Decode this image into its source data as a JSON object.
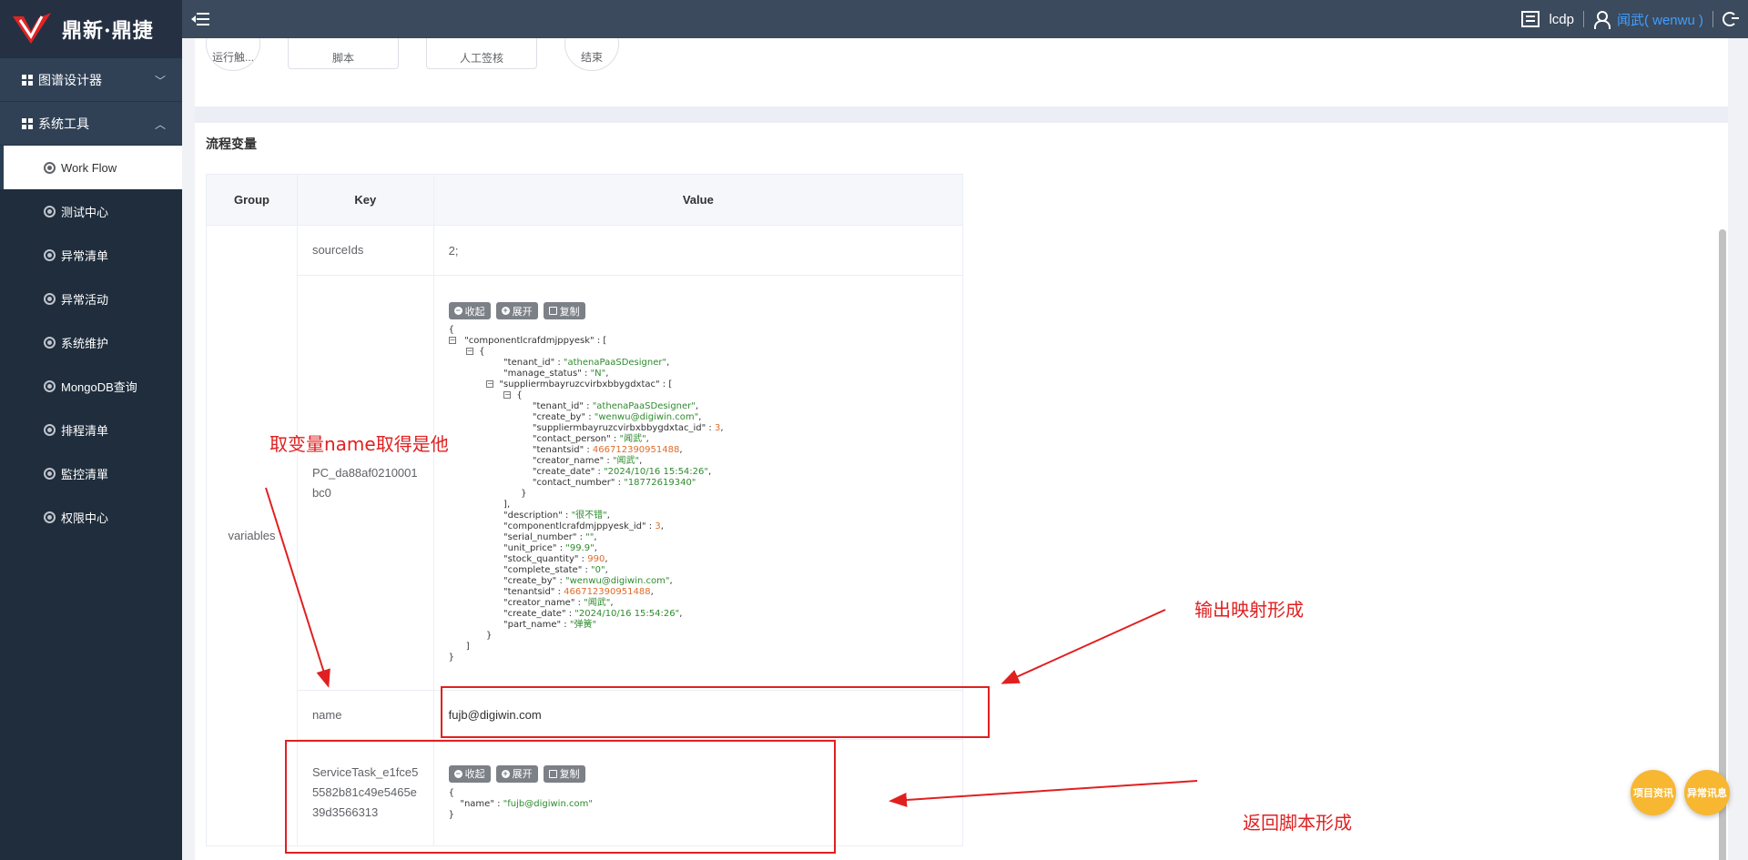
{
  "brand": {
    "logo_text_red_1": "鼎新",
    "logo_dot": "·",
    "logo_text_red_2": "鼎捷"
  },
  "topbar": {
    "tenant": "lcdp",
    "user": "闻武( wenwu )"
  },
  "sidebar": {
    "groups": [
      {
        "label": "图谱设计器",
        "expanded": false
      },
      {
        "label": "系统工具",
        "expanded": true
      }
    ],
    "items": [
      {
        "label": "Work Flow",
        "active": true
      },
      {
        "label": "测试中心"
      },
      {
        "label": "异常清单"
      },
      {
        "label": "异常活动"
      },
      {
        "label": "系统维护"
      },
      {
        "label": "MongoDB查询"
      },
      {
        "label": "排程清单"
      },
      {
        "label": "監控清單"
      },
      {
        "label": "权限中心"
      }
    ]
  },
  "flow": {
    "nodes": [
      "运行触...",
      "脚本",
      "人工签核",
      "结束"
    ]
  },
  "section": {
    "title": "流程变量"
  },
  "table": {
    "headers": {
      "group": "Group",
      "key": "Key",
      "value": "Value"
    },
    "group_value": "variables",
    "rows": [
      {
        "key": "sourceIds",
        "value": "2;"
      },
      {
        "key": "PC_da88af0210001bc0"
      },
      {
        "key": "name",
        "value": "fujb@digiwin.com"
      },
      {
        "key": "ServiceTask_e1fce55582b81c49e5465e39d3566313"
      }
    ]
  },
  "json_toolbar": {
    "collapse": "收起",
    "expand": "展开",
    "copy": "复制"
  },
  "json_pc": {
    "root_key": "componentlcrafdmjppyesk",
    "inner": [
      {
        "k": "tenant_id",
        "v": "athenaPaaSDesigner",
        "t": "s"
      },
      {
        "k": "manage_status",
        "v": "N",
        "t": "s"
      },
      {
        "k": "suppliermbayruzcvirbxbbygdxtac",
        "v": "[",
        "t": "open"
      }
    ],
    "supplier": [
      {
        "k": "tenant_id",
        "v": "athenaPaaSDesigner",
        "t": "s"
      },
      {
        "k": "create_by",
        "v": "wenwu@digiwin.com",
        "t": "s"
      },
      {
        "k": "suppliermbayruzcvirbxbbygdxtac_id",
        "v": "3",
        "t": "n"
      },
      {
        "k": "contact_person",
        "v": "闻武",
        "t": "s"
      },
      {
        "k": "tenantsid",
        "v": "466712390951488",
        "t": "n"
      },
      {
        "k": "creator_name",
        "v": "闻武",
        "t": "s"
      },
      {
        "k": "create_date",
        "v": "2024/10/16 15:54:26",
        "t": "s"
      },
      {
        "k": "contact_number",
        "v": "18772619340",
        "t": "s"
      }
    ],
    "rest": [
      {
        "k": "description",
        "v": "很不错",
        "t": "s"
      },
      {
        "k": "componentlcrafdmjppyesk_id",
        "v": "3",
        "t": "n"
      },
      {
        "k": "serial_number",
        "v": "",
        "t": "s"
      },
      {
        "k": "unit_price",
        "v": "99.9",
        "t": "s"
      },
      {
        "k": "stock_quantity",
        "v": "990",
        "t": "n"
      },
      {
        "k": "complete_state",
        "v": "0",
        "t": "s"
      },
      {
        "k": "create_by",
        "v": "wenwu@digiwin.com",
        "t": "s"
      },
      {
        "k": "tenantsid",
        "v": "466712390951488",
        "t": "n"
      },
      {
        "k": "creator_name",
        "v": "闻武",
        "t": "s"
      },
      {
        "k": "create_date",
        "v": "2024/10/16 15:54:26",
        "t": "s"
      },
      {
        "k": "part_name",
        "v": "弹簧",
        "t": "s"
      }
    ]
  },
  "json_service": {
    "k": "name",
    "v": "fujb@digiwin.com"
  },
  "annotations": {
    "a1": "取变量name取得是他",
    "a2": "输出映射形成",
    "a3": "返回脚本形成",
    "annotation_color": "#e02020"
  },
  "fabs": {
    "project": "项目资讯",
    "exception": "异常讯息"
  },
  "colors": {
    "sidebar": "#1f2d3d",
    "topbar": "#3b4a5c",
    "accent": "#409eff",
    "fab": "#f7b731"
  }
}
